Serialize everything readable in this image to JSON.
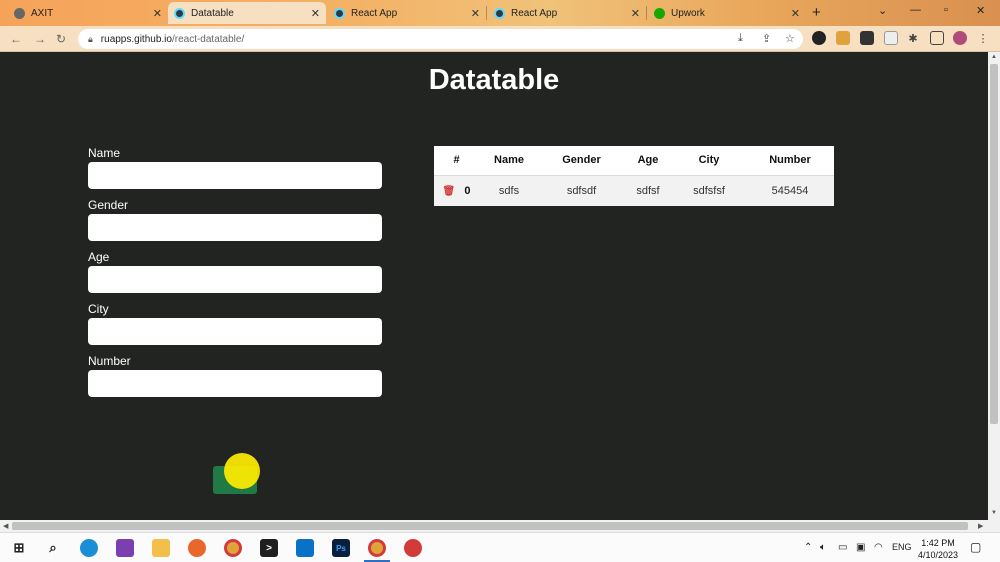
{
  "browser": {
    "tabs": [
      {
        "label": "AXIT",
        "active": false
      },
      {
        "label": "Datatable",
        "active": true
      },
      {
        "label": "React App",
        "active": false
      },
      {
        "label": "React App",
        "active": false
      },
      {
        "label": "Upwork",
        "active": false
      }
    ],
    "url_host": "ruapps.github.io",
    "url_path": "/react-datatable/"
  },
  "page": {
    "title": "Datatable",
    "form": {
      "fields": [
        {
          "label": "Name",
          "value": ""
        },
        {
          "label": "Gender",
          "value": ""
        },
        {
          "label": "Age",
          "value": ""
        },
        {
          "label": "City",
          "value": ""
        },
        {
          "label": "Number",
          "value": ""
        }
      ],
      "submit_label": ""
    },
    "table": {
      "headers": [
        "#",
        "Name",
        "Gender",
        "Age",
        "City",
        "Number"
      ],
      "rows": [
        [
          "0",
          "sdfs",
          "sdfsdf",
          "sdfsf",
          "sdfsfsf",
          "545454"
        ]
      ]
    }
  },
  "taskbar": {
    "language": "ENG",
    "time": "1:42 PM",
    "date": "4/10/2023"
  },
  "colors": {
    "page_background": "#222422",
    "submit_button": "#1f7a46",
    "delete_icon": "#d33a3a"
  }
}
